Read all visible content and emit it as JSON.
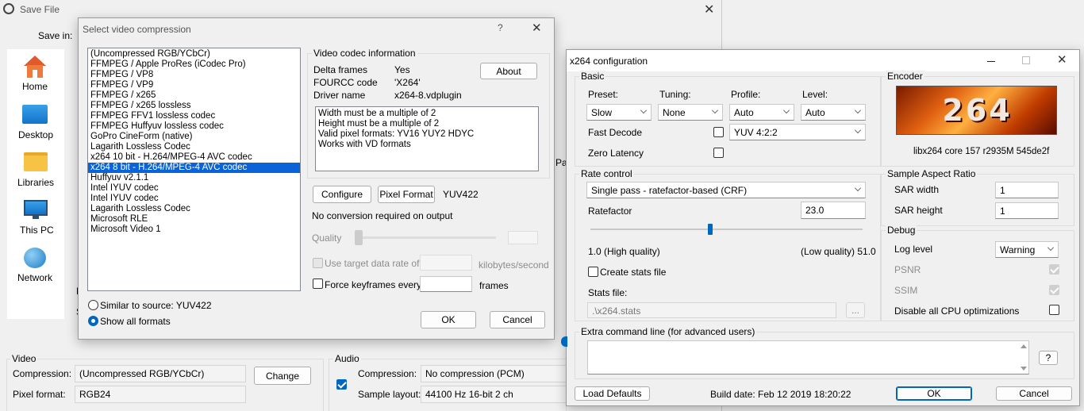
{
  "save_dialog": {
    "title": "Save File",
    "save_in_label": "Save in:",
    "nav": [
      {
        "label": "Home"
      },
      {
        "label": "Desktop"
      },
      {
        "label": "Libraries"
      },
      {
        "label": "This PC"
      },
      {
        "label": "Network"
      }
    ],
    "video": {
      "group": "Video",
      "compression_label": "Compression:",
      "compression_value": "(Uncompressed RGB/YCbCr)",
      "change_button": "Change",
      "pixel_format_label": "Pixel format:",
      "pixel_format_value": "RGB24"
    },
    "audio": {
      "group": "Audio",
      "compression_label": "Compression:",
      "compression_value": "No compression (PCM)",
      "sample_layout_label": "Sample layout:",
      "sample_layout_value": "44100 Hz 16-bit 2 ch"
    },
    "partial_f": "F",
    "partial_s": "S",
    "partial_pa": "Pa"
  },
  "compression_dialog": {
    "title": "Select video compression",
    "help": "?",
    "codecs": [
      "(Uncompressed RGB/YCbCr)",
      "FFMPEG / Apple ProRes (iCodec Pro)",
      "FFMPEG / VP8",
      "FFMPEG / VP9",
      "FFMPEG / x265",
      "FFMPEG / x265 lossless",
      "FFMPEG FFV1 lossless codec",
      "FFMPEG Huffyuv lossless codec",
      "GoPro CineForm (native)",
      "Lagarith Lossless Codec",
      "x264 10 bit - H.264/MPEG-4 AVC codec",
      "x264 8 bit - H.264/MPEG-4 AVC codec",
      "Huffyuv v2.1.1",
      "Intel IYUV codec",
      "Intel IYUV codec",
      "Lagarith Lossless Codec",
      "Microsoft RLE",
      "Microsoft Video 1"
    ],
    "selected_index": 11,
    "similar_label": "Similar to source: YUV422",
    "show_all_label": "Show all formats",
    "info_group": "Video codec information",
    "delta_frames_label": "Delta frames",
    "delta_frames_value": "Yes",
    "fourcc_label": "FOURCC code",
    "fourcc_value": "'X264'",
    "driver_label": "Driver name",
    "driver_value": "x264-8.vdplugin",
    "about_button": "About",
    "notes": [
      "Width must be a multiple of 2",
      "Height must be a multiple of 2",
      "Valid pixel formats: YV16 YUY2 HDYC",
      "Works with VD formats"
    ],
    "configure_button": "Configure",
    "pixel_format_button": "Pixel Format",
    "pixel_format_value": "YUV422",
    "conversion_text": "No conversion required on output",
    "quality_label": "Quality",
    "target_rate_label": "Use target data rate of",
    "rate_unit": "kilobytes/second",
    "keyframes_label": "Force keyframes every",
    "frames_unit": "frames",
    "ok_button": "OK",
    "cancel_button": "Cancel"
  },
  "x264_dialog": {
    "title": "x264 configuration",
    "basic_group": "Basic",
    "preset_label": "Preset:",
    "preset_value": "Slow",
    "tuning_label": "Tuning:",
    "tuning_value": "None",
    "profile_label": "Profile:",
    "profile_value": "Auto",
    "level_label": "Level:",
    "level_value": "Auto",
    "fast_decode_label": "Fast Decode",
    "chroma_value": "YUV 4:2:2",
    "zero_latency_label": "Zero Latency",
    "encoder_group": "Encoder",
    "logo_text": "264",
    "encoder_version": "libx264 core 157 r2935M 545de2f",
    "rate_control_group": "Rate control",
    "rate_mode_value": "Single pass - ratefactor-based (CRF)",
    "ratefactor_label": "Ratefactor",
    "ratefactor_value": "23.0",
    "slider_fraction": 0.44,
    "high_quality_label": "1.0 (High quality)",
    "low_quality_label": "(Low quality) 51.0",
    "create_stats_label": "Create stats file",
    "stats_file_label": "Stats file:",
    "stats_file_value": ".\\x264.stats",
    "browse_button": "...",
    "sar_group": "Sample Aspect Ratio",
    "sar_width_label": "SAR width",
    "sar_width_value": "1",
    "sar_height_label": "SAR height",
    "sar_height_value": "1",
    "debug_group": "Debug",
    "log_level_label": "Log level",
    "log_level_value": "Warning",
    "psnr_label": "PSNR",
    "ssim_label": "SSIM",
    "disable_cpu_label": "Disable all CPU optimizations",
    "extra_group": "Extra command line (for advanced users)",
    "help_button": "?",
    "load_defaults_button": "Load Defaults",
    "build_date": "Build date: Feb 12 2019 18:20:22",
    "ok_button": "OK",
    "cancel_button": "Cancel"
  },
  "colors": {
    "accent": "#0067c0",
    "selection": "#0a64d8"
  }
}
